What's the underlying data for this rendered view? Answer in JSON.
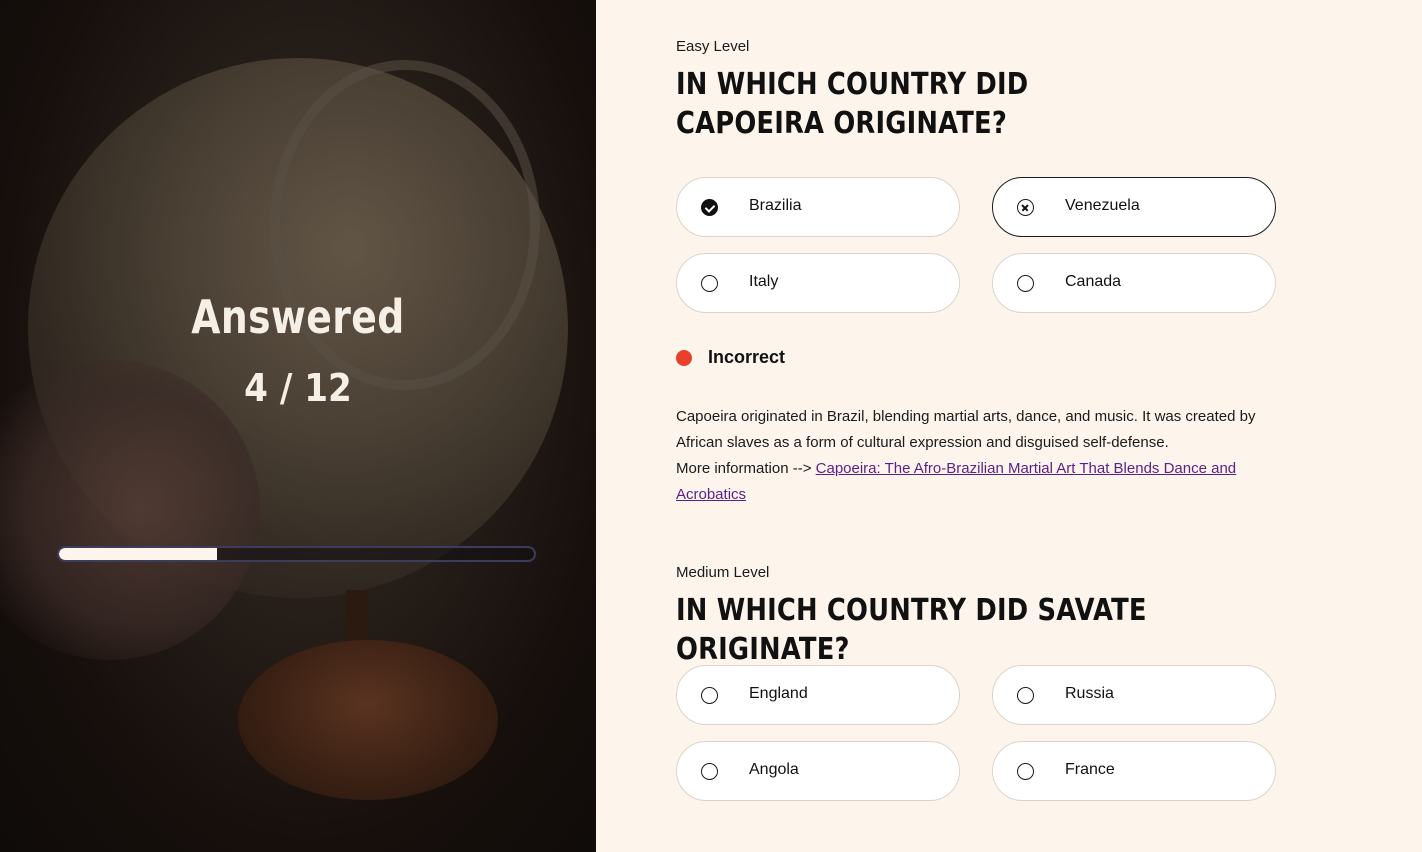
{
  "left_panel": {
    "title": "Answered",
    "count": "4 / 12",
    "progress_fraction": 0.333
  },
  "questions": [
    {
      "level": "Easy Level",
      "question": "IN WHICH COUNTRY DID CAPOEIRA ORIGINATE?",
      "options": [
        {
          "label": "Brazilia",
          "state": "correct"
        },
        {
          "label": "Venezuela",
          "state": "selected-wrong"
        },
        {
          "label": "Italy",
          "state": "unselected"
        },
        {
          "label": "Canada",
          "state": "unselected"
        }
      ],
      "result": {
        "label": "Incorrect",
        "color": "#e8402a"
      },
      "explanation": "Capoeira originated in Brazil, blending martial arts, dance, and music. It was created by African slaves as a form of cultural expression and disguised self-defense.",
      "more_info_prefix": "More information -->",
      "more_info_link": "Capoeira: The Afro-Brazilian Martial Art That Blends Dance and Acrobatics"
    },
    {
      "level": "Medium Level",
      "question": "IN WHICH COUNTRY DID SAVATE ORIGINATE?",
      "options": [
        {
          "label": "England",
          "state": "unselected"
        },
        {
          "label": "Russia",
          "state": "unselected"
        },
        {
          "label": "Angola",
          "state": "unselected"
        },
        {
          "label": "France",
          "state": "unselected"
        }
      ]
    }
  ],
  "colors": {
    "background": "#fdf5ec",
    "incorrect": "#e8402a",
    "link": "#5a1f8a"
  }
}
